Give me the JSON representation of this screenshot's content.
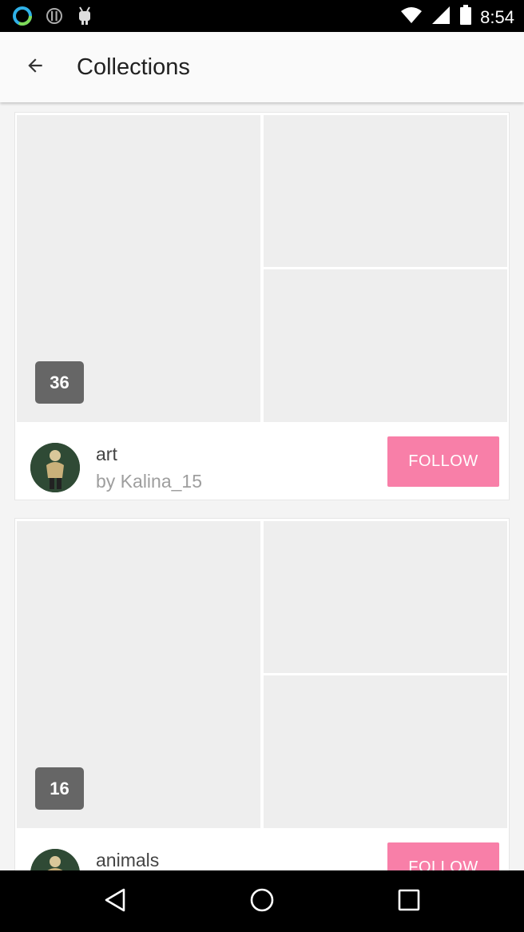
{
  "status_bar": {
    "time": "8:54",
    "icons": [
      "circle-ring-icon",
      "alert-icon",
      "android-icon",
      "wifi-icon",
      "signal-icon",
      "battery-icon"
    ]
  },
  "app_bar": {
    "title": "Collections",
    "back_icon": "arrow-back-icon"
  },
  "collections": [
    {
      "count": "36",
      "name": "art",
      "author": "by Kalina_15",
      "follow_label": "FOLLOW"
    },
    {
      "count": "16",
      "name": "animals",
      "author": "",
      "follow_label": "FOLLOW"
    }
  ],
  "colors": {
    "follow_button": "#f87fa8",
    "badge": "#666666",
    "tile_placeholder": "#eeeeee"
  },
  "nav_bar": {
    "icons": [
      "back-triangle-icon",
      "home-circle-icon",
      "recents-square-icon"
    ]
  }
}
